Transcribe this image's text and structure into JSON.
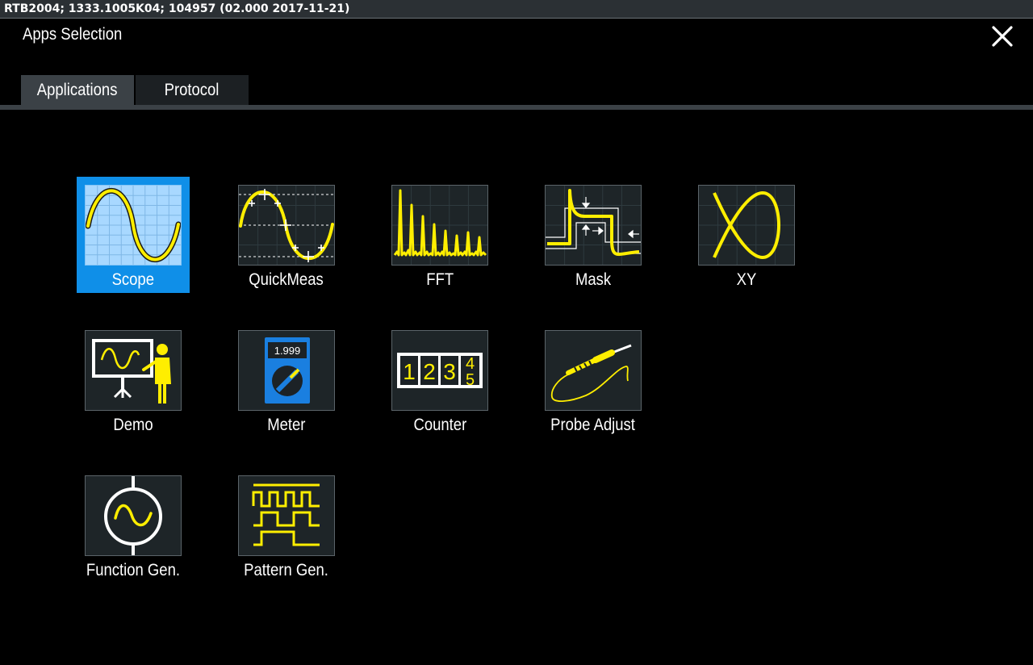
{
  "system_bar": {
    "text": "RTB2004; 1333.1005K04; 104957 (02.000 2017-11-21)"
  },
  "dialog": {
    "title": "Apps Selection",
    "close_icon": "close-x-icon"
  },
  "tabs": [
    {
      "label": "Applications",
      "active": true
    },
    {
      "label": "Protocol",
      "active": false
    }
  ],
  "apps": [
    {
      "label": "Scope",
      "icon": "scope-sine-icon",
      "selected": true
    },
    {
      "label": "QuickMeas",
      "icon": "quickmeas-icon",
      "selected": false
    },
    {
      "label": "FFT",
      "icon": "fft-spectrum-icon",
      "selected": false
    },
    {
      "label": "Mask",
      "icon": "mask-test-icon",
      "selected": false
    },
    {
      "label": "XY",
      "icon": "xy-lissajous-icon",
      "selected": false
    },
    {
      "label": "Demo",
      "icon": "demo-presenter-icon",
      "selected": false
    },
    {
      "label": "Meter",
      "icon": "multimeter-icon",
      "meter_value": "1.999",
      "selected": false
    },
    {
      "label": "Counter",
      "icon": "counter-digits-icon",
      "digits": [
        "1",
        "2",
        "3",
        "4",
        "5"
      ],
      "selected": false
    },
    {
      "label": "Probe Adjust",
      "icon": "probe-icon",
      "selected": false
    },
    {
      "label": "Function Gen.",
      "icon": "function-generator-icon",
      "selected": false
    },
    {
      "label": "Pattern Gen.",
      "icon": "pattern-generator-icon",
      "selected": false
    }
  ],
  "colors": {
    "accent_yellow": "#ffee00",
    "selection_blue": "#0f8fe8",
    "selected_icon_bg": "#a8d8ff",
    "icon_bg": "#1e2528",
    "meter_blue": "#1a7fe0"
  }
}
